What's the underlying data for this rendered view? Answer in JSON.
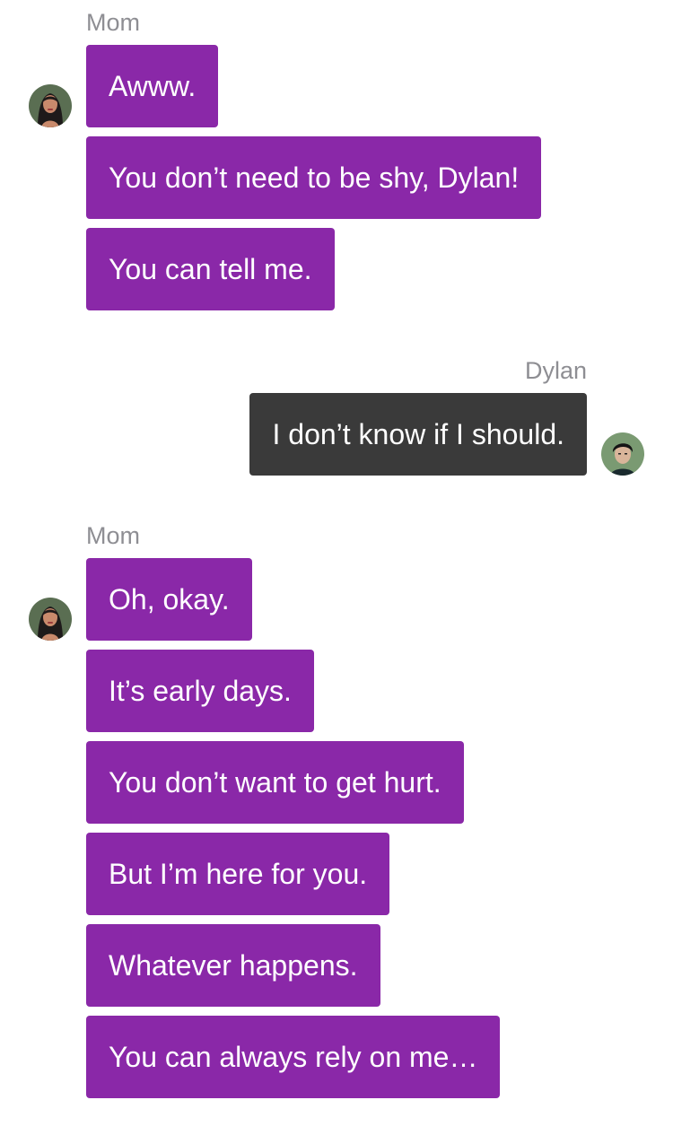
{
  "groups": [
    {
      "sender": "Mom",
      "avatar_icon": "mom-avatar",
      "messages": [
        "Awww.",
        "You don’t need to be shy, Dylan!",
        "You can tell me."
      ]
    },
    {
      "sender": "Dylan",
      "avatar_icon": "dylan-avatar",
      "messages": [
        "I don’t know if I should."
      ]
    },
    {
      "sender": "Mom",
      "avatar_icon": "mom-avatar",
      "messages": [
        "Oh, okay.",
        "It’s early days.",
        "You don’t want to get hurt.",
        "But I’m here for you.",
        "Whatever happens.",
        "You can always rely on me…"
      ]
    }
  ],
  "colors": {
    "mom_bubble": "#8a28a8",
    "dylan_bubble": "#3a3a3a",
    "sender_label": "#8e8e93",
    "background": "#ffffff"
  }
}
